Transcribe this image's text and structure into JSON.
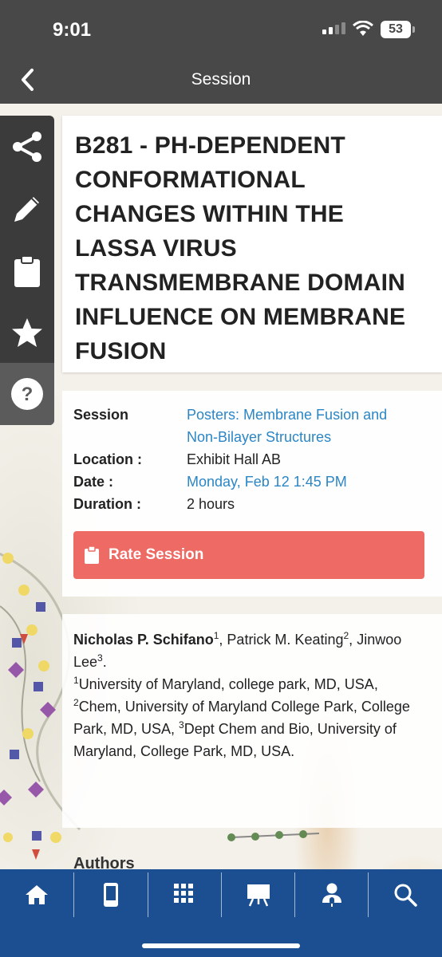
{
  "status_bar": {
    "time": "9:01",
    "battery": "53"
  },
  "header": {
    "title": "Session"
  },
  "rail": {
    "icons": [
      "share-icon",
      "pencil-icon",
      "clipboard-icon",
      "star-icon",
      "help-icon"
    ]
  },
  "session": {
    "title": "B281 - PH-DEPENDENT CONFORMATIONAL CHANGES WITHIN THE LASSA VIRUS TRANSMEMBRANE DOMAIN INFLUENCE ON MEMBRANE FUSION",
    "details": {
      "session_label": "Session",
      "session_value_line1": "Posters: Membrane Fusion and",
      "session_value_line2": "Non-Bilayer Structures",
      "location_label": "Location :",
      "location_value": "Exhibit Hall AB",
      "date_label": "Date :",
      "date_value": "Monday, Feb 12 1:45 PM",
      "duration_label": "Duration :",
      "duration_value": "2 hours"
    },
    "rate_button": "Rate Session"
  },
  "authors": {
    "a1": "Nicholas P. Schifano",
    "a1_sup": "1",
    "a2": ", Patrick M. Keating",
    "a2_sup": "2",
    "a3_prefix": ",",
    "a3": "Jinwoo Lee",
    "a3_sup": "3",
    "a3_suffix": ".",
    "aff1_sup": "1",
    "aff1": "University of Maryland, college park, MD, USA, ",
    "aff2_sup": "2",
    "aff2": "Chem, University of Maryland College Park, College Park, MD, USA, ",
    "aff3_sup": "3",
    "aff3": "Dept Chem and Bio, University of Maryland, College Park, MD, USA."
  },
  "next_section_peek": "Authors",
  "tabbar": {
    "icons": [
      "home-icon",
      "phone-icon",
      "grid-icon",
      "presentation-icon",
      "speaker-icon",
      "search-icon"
    ]
  },
  "colors": {
    "header": "#484848",
    "accent_link": "#2b86c5",
    "rate_button": "#ee6a64",
    "tabbar": "#1c4f91"
  }
}
